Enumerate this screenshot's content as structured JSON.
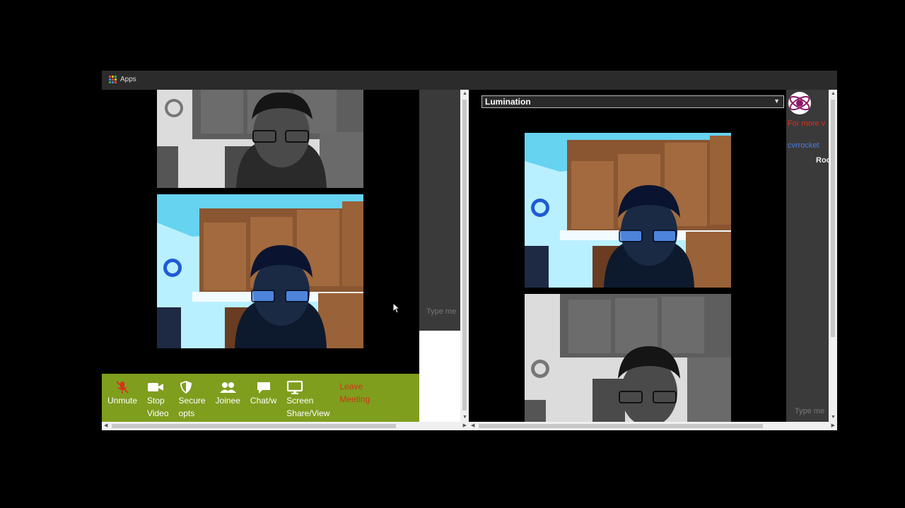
{
  "bookmarks_bar": {
    "apps_label": "Apps"
  },
  "controls": {
    "unmute": "Unmute",
    "stop_video": "Stop\nVideo",
    "secure_opts": "Secure\nopts",
    "joinee": "Joinee",
    "chat": "Chat/w",
    "screen_share": "Screen\nShare/View",
    "leave_meeting": "Leave\nMeeting"
  },
  "left_chat": {
    "placeholder": "Type me"
  },
  "right_panel": {
    "room_select_value": "Lumination",
    "promo_text": "For more v",
    "username": "cvrrocket",
    "room_label": "Roo",
    "chat_placeholder": "Type me"
  },
  "colors": {
    "toolbar": "#7f9e1e",
    "leave_meeting": "#d9301c",
    "promo": "#d9301c",
    "username_link": "#4a7ee0"
  },
  "icons": {
    "unmute": "muted-mic-icon",
    "stop_video": "video-camera-icon",
    "secure_opts": "shield-icon",
    "joinee": "people-icon",
    "chat": "chat-bubble-icon",
    "screen_share": "monitor-icon"
  }
}
